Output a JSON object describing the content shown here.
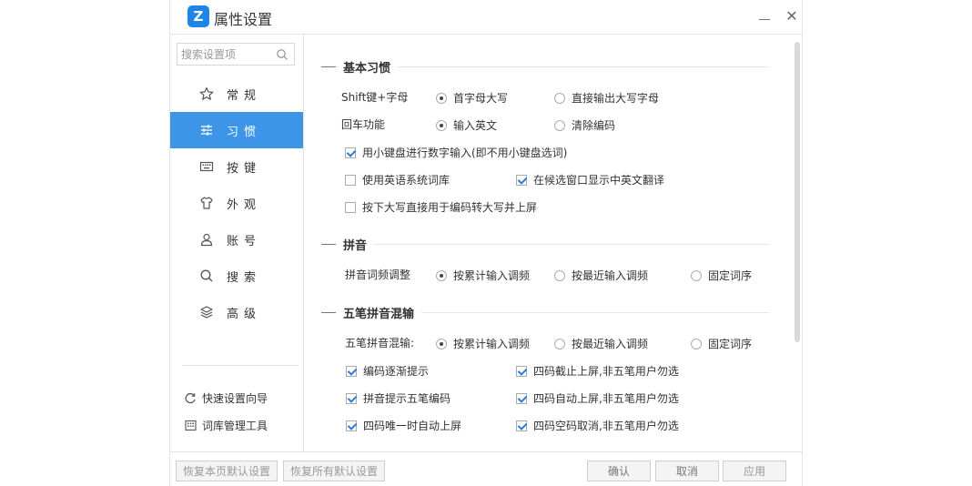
{
  "window": {
    "title": "属性设置",
    "logo_glyph": "Z",
    "close_glyph": "✕",
    "accent_color": "#3c95e6"
  },
  "sidebar": {
    "search_placeholder": "搜索设置项",
    "items": [
      {
        "label": "常规",
        "icon": "star-icon",
        "active": false
      },
      {
        "label": "习惯",
        "icon": "sliders-icon",
        "active": true
      },
      {
        "label": "按键",
        "icon": "keyboard-icon",
        "active": false
      },
      {
        "label": "外观",
        "icon": "shirt-icon",
        "active": false
      },
      {
        "label": "账号",
        "icon": "user-icon",
        "active": false
      },
      {
        "label": "搜索",
        "icon": "search-icon",
        "active": false
      },
      {
        "label": "高级",
        "icon": "layers-icon",
        "active": false
      }
    ],
    "tools": [
      {
        "label": "快速设置向导",
        "icon": "refresh-icon"
      },
      {
        "label": "词库管理工具",
        "icon": "grid-icon"
      }
    ]
  },
  "content": {
    "basic": {
      "title": "基本习惯",
      "shift_label": "Shift键+字母",
      "shift_opt1": "首字母大写",
      "shift_opt2": "直接输出大写字母",
      "enter_label": "回车功能",
      "enter_opt1": "输入英文",
      "enter_opt2": "清除编码",
      "numpad": "用小键盘进行数字输入(即不用小键盘选词)",
      "english_dict": "使用英语系统词库",
      "show_translation": "在候选窗口显示中英文翻译",
      "caps_lock": "按下大写直接用于编码转大写并上屏"
    },
    "pinyin": {
      "title": "拼音",
      "freq_label": "拼音词频调整",
      "opt1": "按累计输入调频",
      "opt2": "按最近输入调频",
      "opt3": "固定词序"
    },
    "wubi": {
      "title": "五笔拼音混输",
      "mix_label": "五笔拼音混输:",
      "opt1": "按累计输入调频",
      "opt2": "按最近输入调频",
      "opt3": "固定词序",
      "c1": "编码逐渐提示",
      "c2": "四码截止上屏,非五笔用户勿选",
      "c3": "拼音提示五笔编码",
      "c4": "四码自动上屏,非五笔用户勿选",
      "c5": "四码唯一时自动上屏",
      "c6": "四码空码取消,非五笔用户勿选"
    }
  },
  "footer": {
    "restore_page": "恢复本页默认设置",
    "restore_all": "恢复所有默认设置",
    "ok": "确认",
    "cancel": "取消",
    "apply": "应用"
  }
}
